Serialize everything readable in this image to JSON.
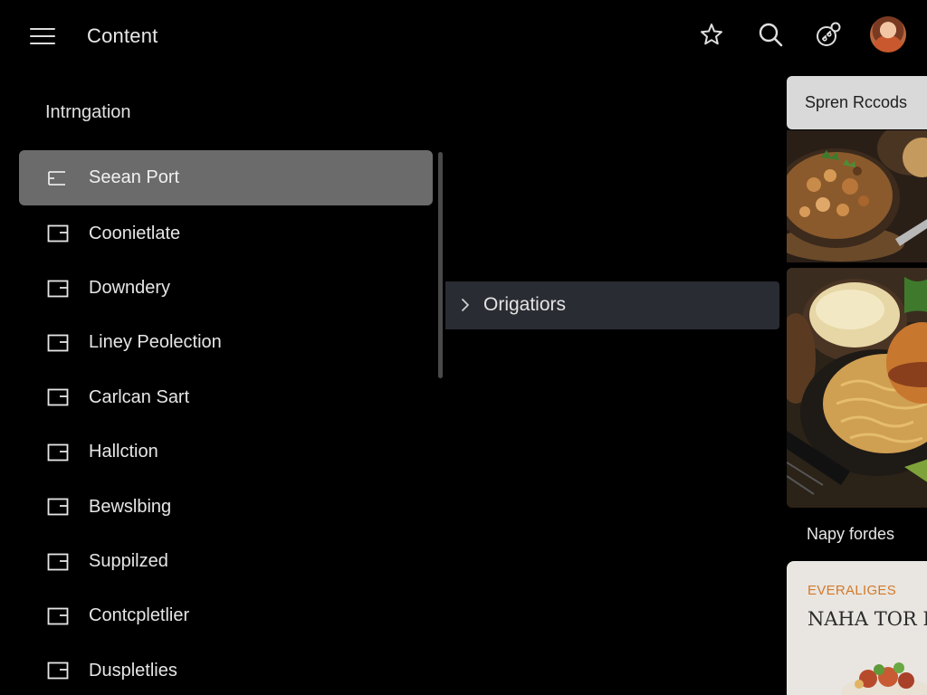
{
  "header": {
    "title": "Content",
    "icons": [
      "menu-icon",
      "star-icon",
      "search-icon",
      "links-icon",
      "avatar"
    ]
  },
  "sidebar": {
    "heading": "Intrngation",
    "items": [
      {
        "label": "Seean Port",
        "icon": "list-icon",
        "active": true
      },
      {
        "label": "Coonietlate",
        "icon": "folder-icon"
      },
      {
        "label": "Downdery",
        "icon": "folder-icon"
      },
      {
        "label": "Liney Peolection",
        "icon": "folder-icon"
      },
      {
        "label": "Carlcan Sart",
        "icon": "folder-icon"
      },
      {
        "label": "Hallction",
        "icon": "folder-icon"
      },
      {
        "label": "Bewslbing",
        "icon": "folder-icon"
      },
      {
        "label": "Suppilzed",
        "icon": "folder-icon"
      },
      {
        "label": "Contcpletlier",
        "icon": "folder-icon"
      },
      {
        "label": "Duspletlies",
        "icon": "folder-icon"
      }
    ]
  },
  "middle": {
    "row_label": "Origatiors"
  },
  "right": {
    "card_label": "Spren Rccods",
    "caption": "Napy fordes",
    "promo_kicker": "EVERALIGES",
    "promo_title": "NAHA TOR PU"
  },
  "colors": {
    "background": "#000000",
    "active_item": "#6b6b6b",
    "row_bg": "#2a2c33",
    "card_bg": "#d9d9d9",
    "accent_orange": "#d17a2c"
  }
}
